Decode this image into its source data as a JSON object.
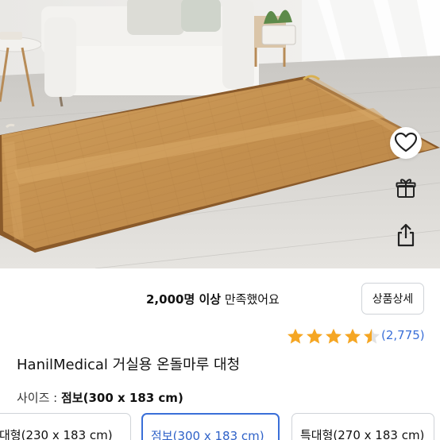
{
  "product_image": {
    "subject": "wood-grain heated floor mat in a living room",
    "icons": [
      "heart-icon",
      "gift-icon",
      "share-icon"
    ]
  },
  "rating": {
    "count_text": "2,000명 이상",
    "satisfied_text": " 만족했어요",
    "detail_button_label": "상품상세",
    "stars": 4.5,
    "review_count": "(2,775)",
    "star_color": "#f5a623"
  },
  "product": {
    "title": "HanilMedical 거실용 온돌마루 대청"
  },
  "size": {
    "label": "사이즈 : ",
    "selected_value": "점보(300 x 183 cm)",
    "options": [
      {
        "label": "대형(230 x 183 cm)",
        "selected": false
      },
      {
        "label": "점보(300 x 183 cm)",
        "selected": true
      },
      {
        "label": "특대형(270 x 183 cm)",
        "selected": false
      }
    ]
  },
  "colors": {
    "accent": "#3a6fd8",
    "mat": "#c99a5a"
  }
}
